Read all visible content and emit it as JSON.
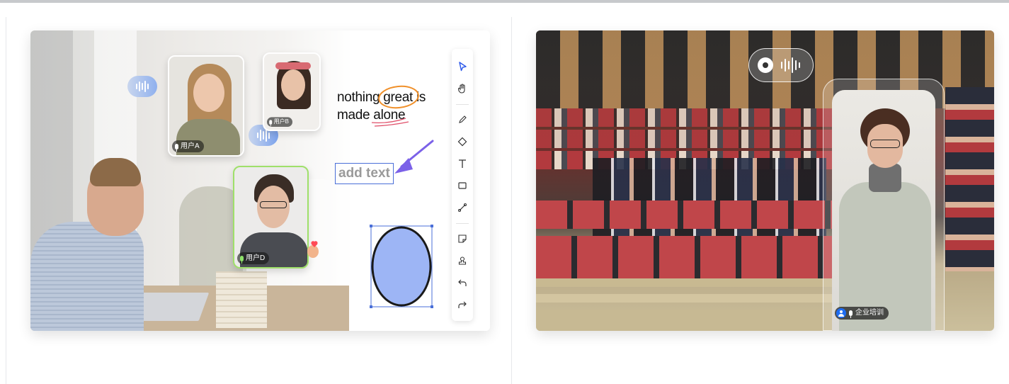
{
  "left_panel": {
    "participants": [
      {
        "label": "用户A",
        "mic": "muted"
      },
      {
        "label": "用户B",
        "mic": "muted"
      },
      {
        "label": "用户D",
        "mic": "speaking"
      }
    ],
    "handwriting": {
      "line1": "nothing great is",
      "line2": "made alone"
    },
    "text_box": "add text",
    "toolbar": {
      "tools": [
        "select-icon",
        "hand-icon",
        "pen-icon",
        "eraser-icon",
        "text-icon",
        "shape-icon",
        "line-icon",
        "sticky-note-icon",
        "stamp-icon",
        "undo-icon",
        "redo-icon"
      ]
    },
    "colors": {
      "accent": "#4a6fd8",
      "circle_fill": "#9db5f5",
      "annotation": "#f0902a",
      "speaking_border": "#9fe06a"
    }
  },
  "right_panel": {
    "presenter_label": "企业培训",
    "colors": {
      "presenter_badge": "#1e6cf2"
    }
  }
}
